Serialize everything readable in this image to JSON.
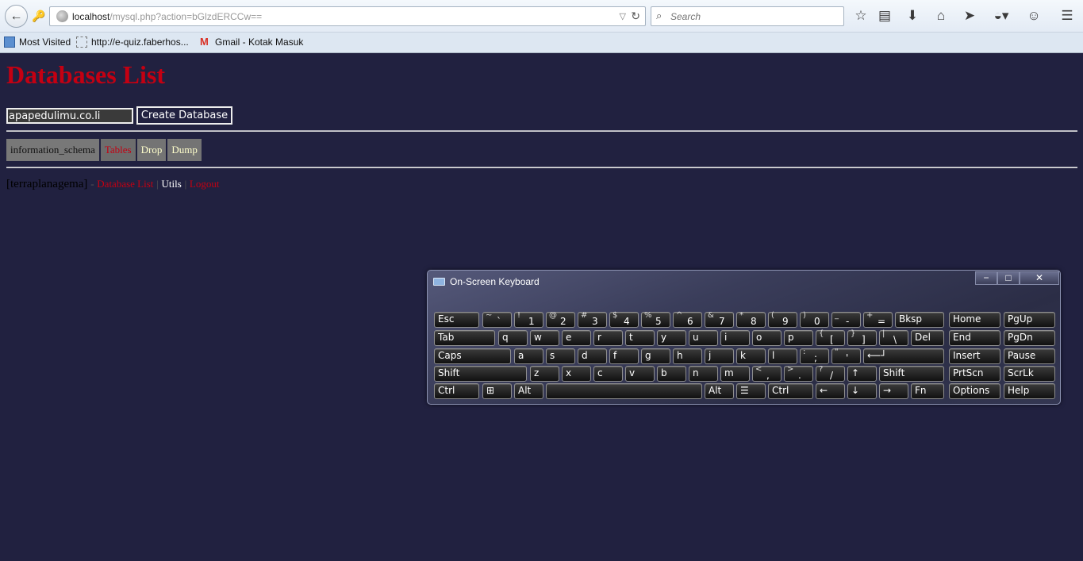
{
  "browser": {
    "url_host": "localhost",
    "url_path": "/mysql.php?action=bGlzdERCCw==",
    "search_placeholder": "Search",
    "bookmarks": [
      {
        "label": "Most Visited"
      },
      {
        "label": "http://e-quiz.faberhos..."
      },
      {
        "label": "Gmail - Kotak Masuk"
      }
    ]
  },
  "page": {
    "title": "Databases List",
    "db_input_value": "apapedulimu.co.li",
    "create_button": "Create Database",
    "table_row": {
      "name": "information_schema",
      "tables": "Tables",
      "drop": "Drop",
      "dump": "Dump"
    },
    "footer": {
      "user": "[terraplanagema]",
      "dash": "-",
      "database_list": "Database List",
      "sep1": "|",
      "utils": "Utils",
      "sep2": "|",
      "logout": "Logout"
    },
    "colors": {
      "background": "#212140",
      "accent_red": "#c40012"
    }
  },
  "osk": {
    "title": "On-Screen Keyboard",
    "controls": [
      "−",
      "□",
      "✕"
    ],
    "keys": {
      "esc": "Esc",
      "bksp": "Bksp",
      "home": "Home",
      "pgup": "PgUp",
      "tab": "Tab",
      "del": "Del",
      "end": "End",
      "pgdn": "PgDn",
      "caps": "Caps",
      "insert": "Insert",
      "pause": "Pause",
      "shift": "Shift",
      "prtscn": "PrtScn",
      "scrlk": "ScrLk",
      "ctrl": "Ctrl",
      "alt": "Alt",
      "fn": "Fn",
      "options": "Options",
      "help": "Help",
      "enter": "⟵┘",
      "up": "↑",
      "left": "←",
      "down": "↓",
      "right": "→",
      "row1_shift": [
        "~",
        "!",
        "@",
        "#",
        "$",
        "%",
        "^",
        "&",
        "*",
        "(",
        ")",
        "_",
        "+"
      ],
      "row1_base": [
        "`",
        "1",
        "2",
        "3",
        "4",
        "5",
        "6",
        "7",
        "8",
        "9",
        "0",
        "-",
        "="
      ],
      "row2": [
        "q",
        "w",
        "e",
        "r",
        "t",
        "y",
        "u",
        "i",
        "o",
        "p"
      ],
      "row2_shift": [
        "{",
        "}",
        "|"
      ],
      "row2_base": [
        "[",
        "]",
        "\\"
      ],
      "row3": [
        "a",
        "s",
        "d",
        "f",
        "g",
        "h",
        "j",
        "k",
        "l"
      ],
      "row3_shift": [
        ":",
        "\""
      ],
      "row3_base": [
        ";",
        "'"
      ],
      "row4": [
        "z",
        "x",
        "c",
        "v",
        "b",
        "n",
        "m"
      ],
      "row4_shift": [
        "<",
        ">",
        "?"
      ],
      "row4_base": [
        ",",
        ".",
        "/"
      ]
    }
  }
}
